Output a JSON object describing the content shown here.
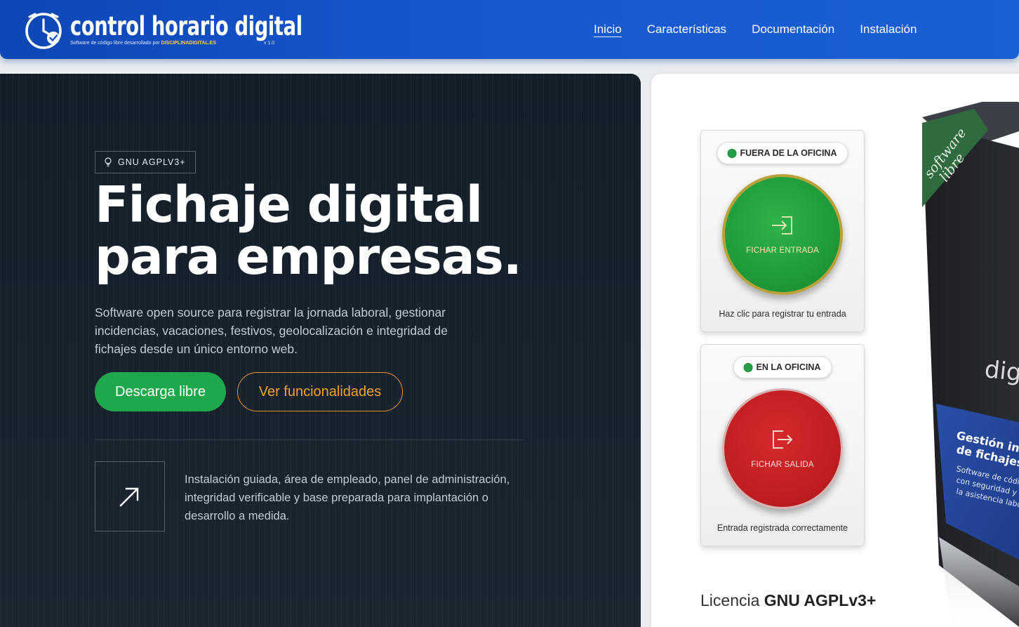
{
  "header": {
    "logo_title": "control horario digital",
    "logo_subtitle": "Software de código libre desarrollado por",
    "logo_brand": "DISCIPLINADIGITAL.ES",
    "logo_version": "v 1.0",
    "nav": [
      {
        "label": "Inicio",
        "active": true
      },
      {
        "label": "Características",
        "active": false
      },
      {
        "label": "Documentación",
        "active": false
      },
      {
        "label": "Instalación",
        "active": false
      }
    ]
  },
  "hero": {
    "badge": "GNU AGPLV3+",
    "title_line1": "Fichaje digital",
    "title_line2": "para empresas.",
    "description": "Software open source para registrar la jornada laboral, gestionar incidencias, vacaciones, festivos, geolocalización e integridad de fichajes desde un único entorno web.",
    "primary_button": "Descarga libre",
    "secondary_button": "Ver funcionalidades",
    "feature_text": "Instalación guiada, área de empleado, panel de administración, integridad verificable y base preparada para implantación o desarrollo a medida."
  },
  "panel": {
    "card1": {
      "status": "FUERA DE LA OFICINA",
      "button": "FICHAR ENTRADA",
      "footer": "Haz clic para registrar tu entrada"
    },
    "card2": {
      "status": "EN LA OFICINA",
      "button": "FICHAR SALIDA",
      "footer": "Entrada registrada correctamente"
    },
    "license_prefix": "Licencia",
    "license_name": "GNU AGPLv3+",
    "product_box": {
      "ribbon_text_1": "software",
      "ribbon_text_2": "libre",
      "brand_partial": "digit",
      "heading_partial_1": "Gestión inte",
      "heading_partial_2": "de fichajes y",
      "body_partial_1": "Software de códi",
      "body_partial_2": "con seguridad y t",
      "body_partial_3": "la asistencia labo"
    }
  },
  "colors": {
    "header_blue": "#1657cf",
    "hero_dark": "#17212c",
    "primary_green": "#1ea84b",
    "accent_orange": "#e0922a",
    "fichar_red": "#bf1e22"
  },
  "icons": {
    "logo": "clock-check-icon",
    "badge": "bulb-icon",
    "feature": "arrow-up-right-icon",
    "entrada": "sign-in-icon",
    "salida": "sign-out-icon"
  }
}
